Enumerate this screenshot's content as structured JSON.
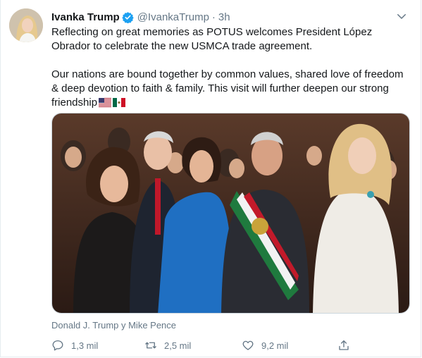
{
  "author": {
    "name": "Ivanka Trump",
    "handle": "@IvankaTrump",
    "separator": "·",
    "time": "3h",
    "avatar_icon": "profile-photo",
    "verified_icon": "verified-badge-icon"
  },
  "tweet": {
    "paragraph1": "Reflecting on great memories as POTUS welcomes President López Obrador to celebrate the new USMCA trade agreement.",
    "paragraph2": "Our nations are bound together by common values, shared love of freedom & deep devotion to faith & family. This visit will further deepen our strong friendship",
    "flags": [
      "us-flag-emoji",
      "mexico-flag-emoji"
    ]
  },
  "media": {
    "description_icon": "group-photo"
  },
  "tagged_people": "Donald J. Trump y Mike Pence",
  "actions": {
    "reply_count": "1,3 mil",
    "retweet_count": "2,5 mil",
    "like_count": "9,2 mil"
  },
  "colors": {
    "accent": "#1da1f2",
    "secondary_text": "#657786",
    "primary_text": "#14171a"
  }
}
